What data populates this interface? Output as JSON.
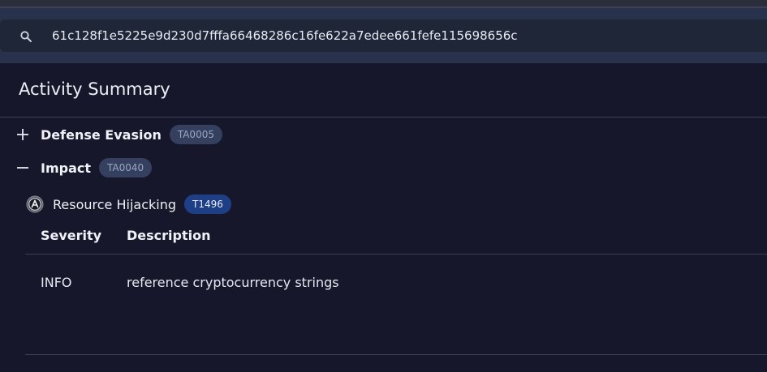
{
  "search": {
    "value": "61c128f1e5225e9d230d7fffa66468286c16fe622a7edee661fefe115698656c"
  },
  "summary": {
    "title": "Activity Summary"
  },
  "tactics": [
    {
      "name": "Defense Evasion",
      "id": "TA0005",
      "expanded": false
    },
    {
      "name": "Impact",
      "id": "TA0040",
      "expanded": true
    }
  ],
  "technique": {
    "name": "Resource Hijacking",
    "id": "T1496",
    "logo_letter": "A"
  },
  "table": {
    "headers": {
      "severity": "Severity",
      "description": "Description"
    },
    "rows": [
      {
        "severity": "INFO",
        "description": "reference cryptocurrency strings"
      }
    ]
  },
  "colors": {
    "background": "#16172a",
    "header_band": "#28324d",
    "tactic_pill": "#34405e",
    "technique_pill": "#1e3f86"
  },
  "icons": {
    "search": "search-icon",
    "expand": "plus-icon",
    "collapse": "minus-icon",
    "technique_logo": "circle-a-logo-icon"
  }
}
